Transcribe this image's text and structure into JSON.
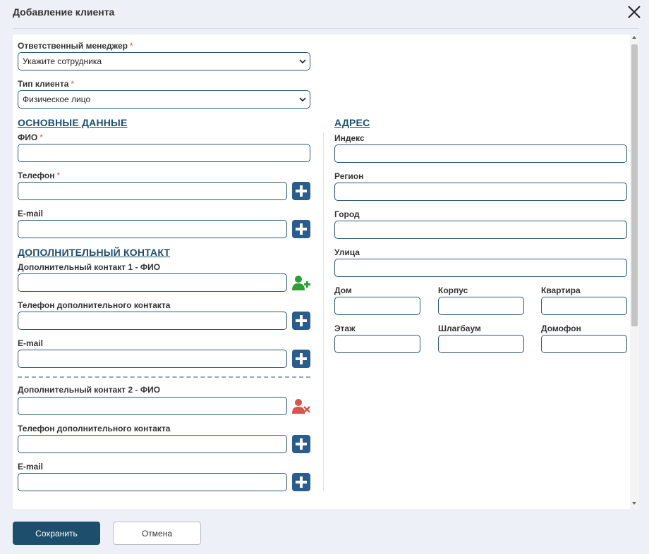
{
  "dialog": {
    "title": "Добавление клиента",
    "close_icon": "close-icon"
  },
  "required_mark": "*",
  "manager": {
    "label": "Ответственный менеджер",
    "selected": "Укажите сотрудника"
  },
  "client_type": {
    "label": "Тип клиента",
    "selected": "Физическое лицо"
  },
  "main_section": {
    "heading": "ОСНОВНЫЕ ДАННЫЕ",
    "fio_label": "ФИО",
    "phone_label": "Телефон",
    "email_label": "E-mail"
  },
  "extra_section": {
    "heading": "ДОПОЛНИТЕЛЬНЫЙ КОНТАКТ",
    "contact1": {
      "fio_label": "Дополнительный контакт 1 - ФИО",
      "phone_label": "Телефон дополнительного контакта",
      "email_label": "E-mail"
    },
    "contact2": {
      "fio_label": "Дополнительный контакт 2 - ФИО",
      "phone_label": "Телефон дополнительного контакта",
      "email_label": "E-mail"
    }
  },
  "address_section": {
    "heading": "АДРЕС",
    "index_label": "Индекс",
    "region_label": "Регион",
    "city_label": "Город",
    "street_label": "Улица",
    "house_label": "Дом",
    "building_label": "Корпус",
    "apartment_label": "Квартира",
    "floor_label": "Этаж",
    "barrier_label": "Шлагбаум",
    "intercom_label": "Домофон"
  },
  "footer": {
    "save_label": "Сохранить",
    "cancel_label": "Отмена"
  },
  "colors": {
    "accent": "#1d4e6b",
    "plus_button": "#2a5d8f",
    "add_contact": "#2e9e3a",
    "remove_contact": "#d9534f",
    "required": "#d9534f"
  }
}
